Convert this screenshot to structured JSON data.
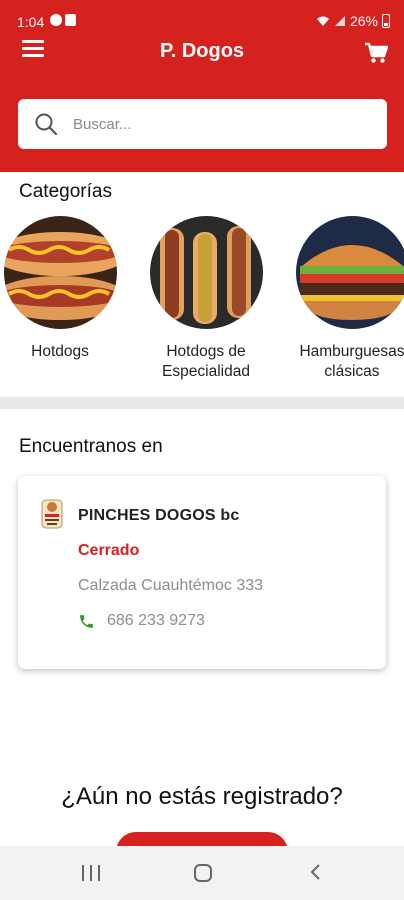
{
  "status_bar": {
    "time": "1:04",
    "battery": "26%"
  },
  "app_bar": {
    "title": "P. Dogos",
    "menu_icon": "menu-icon",
    "cart_icon": "cart-icon"
  },
  "search": {
    "placeholder": "Buscar...",
    "value": ""
  },
  "categories": {
    "title": "Categorías",
    "items": [
      {
        "label": "Hotdogs"
      },
      {
        "label": "Hotdogs de\nEspecialidad"
      },
      {
        "label": "Hamburguesas\nclásicas"
      }
    ]
  },
  "locations": {
    "title": "Encuentranos en",
    "store": {
      "name": "PINCHES DOGOS bc",
      "status": "Cerrado",
      "address": "Calzada Cuauhtémoc 333",
      "phone": "686 233 9273"
    }
  },
  "register": {
    "question": "¿Aún no estás registrado?"
  },
  "colors": {
    "primary": "#d5221e",
    "status_closed": "#d5221e",
    "phone_icon": "#2e9b2e"
  }
}
